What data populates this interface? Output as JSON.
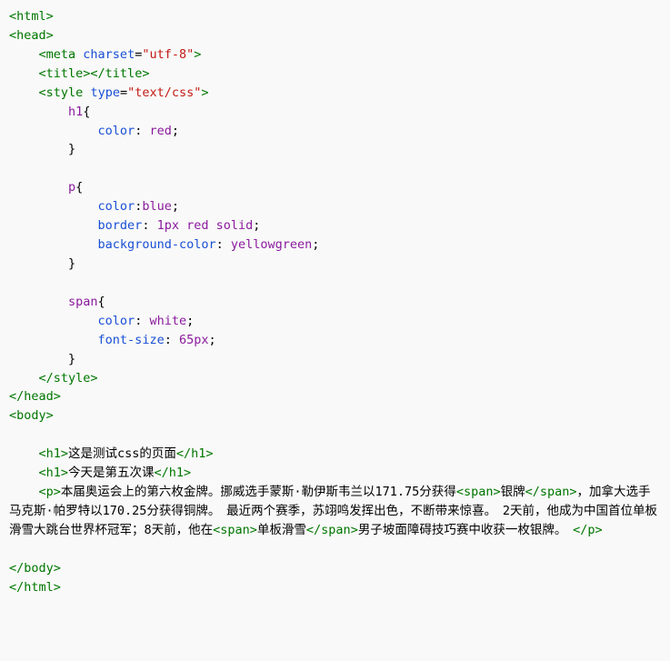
{
  "code": {
    "line01_a": "<html>",
    "line02_a": "<head>",
    "line03_a": "<meta",
    "line03_b": "charset",
    "line03_c": "=",
    "line03_d": "\"utf-8\"",
    "line03_e": ">",
    "line04_a": "<title>",
    "line04_b": "</title>",
    "line05_a": "<style",
    "line05_b": "type",
    "line05_c": "=",
    "line05_d": "\"text/css\"",
    "line05_e": ">",
    "line06_a": "h1",
    "line06_b": "{",
    "line07_a": "color",
    "line07_b": ": ",
    "line07_c": "red",
    "line07_d": ";",
    "line08_a": "}",
    "line10_a": "p",
    "line10_b": "{",
    "line11_a": "color",
    "line11_b": ":",
    "line11_c": "blue",
    "line11_d": ";",
    "line12_a": "border",
    "line12_b": ": ",
    "line12_c": "1px",
    "line12_d": "red",
    "line12_e": "solid",
    "line12_f": ";",
    "line13_a": "background-color",
    "line13_b": ": ",
    "line13_c": "yellowgreen",
    "line13_d": ";",
    "line14_a": "}",
    "line16_a": "span",
    "line16_b": "{",
    "line17_a": "color",
    "line17_b": ": ",
    "line17_c": "white",
    "line17_d": ";",
    "line18_a": "font-size",
    "line18_b": ": ",
    "line18_c": "65px",
    "line18_d": ";",
    "line19_a": "}",
    "line20_a": "</style>",
    "line21_a": "</head>",
    "line22_a": "<body>",
    "line24_a": "<h1>",
    "line24_b": "这是测试css的页面",
    "line24_c": "</h1>",
    "line25_a": "<h1>",
    "line25_b": "今天是第五次课",
    "line25_c": "</h1>",
    "line26_a": "<p>",
    "line26_b": "本届奥运会上的第六枚金牌。挪威选手蒙斯·勒伊斯韦兰以171.75分获得",
    "line26_c": "<span>",
    "line26_d": "银牌",
    "line26_e": "</span>",
    "line26_f": "，加拿大选手马克斯·帕罗特以170.25分获得铜牌。　最近两个赛季，苏翊鸣发挥出色，不断带来惊喜。　2天前，他成为中国首位单板滑雪大跳台世界杯冠军；8天前，他在",
    "line26_g": "<span>",
    "line26_h": "单板滑雪",
    "line26_i": "</span>",
    "line26_j": "男子坡面障碍技巧赛中收获一枚银牌。　",
    "line26_k": "</p>",
    "line28_a": "</body>",
    "line29_a": "</html>"
  }
}
